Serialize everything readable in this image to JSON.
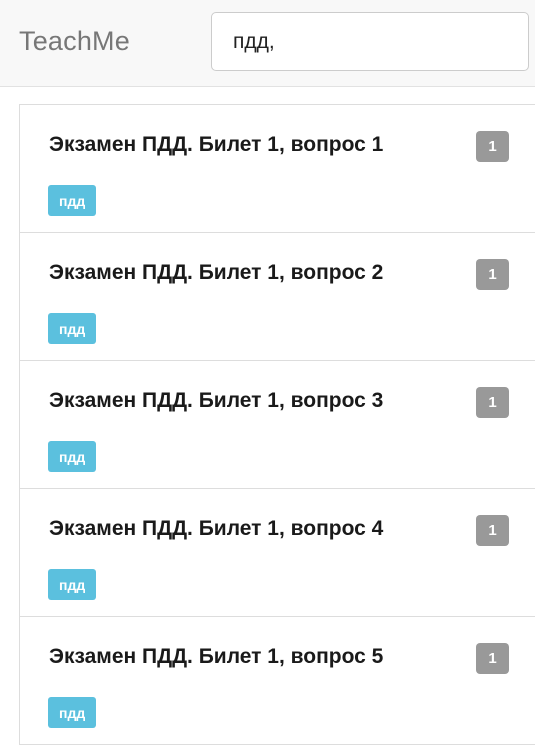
{
  "navbar": {
    "brand": "TeachMe",
    "search": {
      "value": "пдд,"
    }
  },
  "questions": [
    {
      "title": "Экзамен ПДД. Билет 1, вопрос 1",
      "count": "1",
      "tag": "пдд"
    },
    {
      "title": "Экзамен ПДД. Билет 1, вопрос 2",
      "count": "1",
      "tag": "пдд"
    },
    {
      "title": "Экзамен ПДД. Билет 1, вопрос 3",
      "count": "1",
      "tag": "пдд"
    },
    {
      "title": "Экзамен ПДД. Билет 1, вопрос 4",
      "count": "1",
      "tag": "пдд"
    },
    {
      "title": "Экзамен ПДД. Билет 1, вопрос 5",
      "count": "1",
      "tag": "пдд"
    }
  ]
}
